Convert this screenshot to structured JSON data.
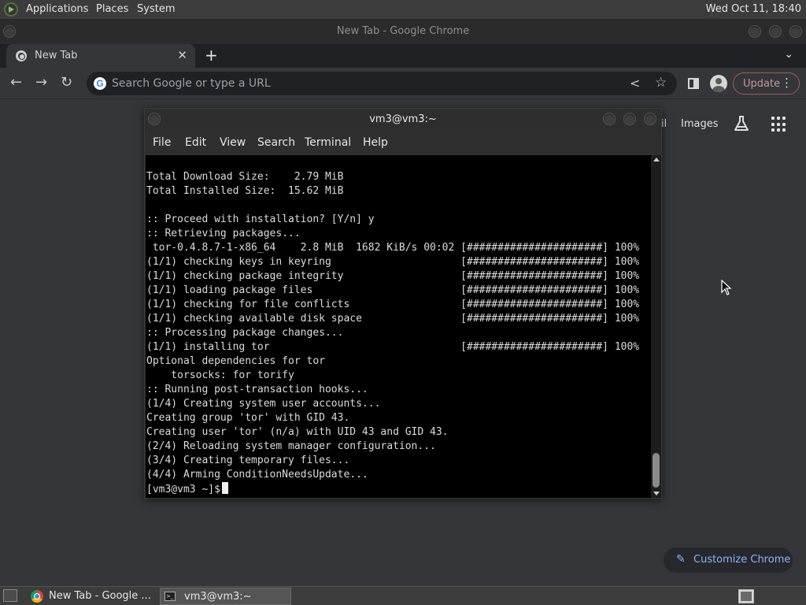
{
  "top_panel": {
    "menus": [
      "Applications",
      "Places",
      "System"
    ],
    "clock": "Wed Oct 11, 18:40"
  },
  "chrome": {
    "window_title": "New Tab - Google Chrome",
    "tab_title": "New Tab",
    "omnibox_placeholder": "Search Google or type a URL",
    "update_label": "Update",
    "ntp": {
      "gmail_tail": "il",
      "images_link": "Images",
      "customize_label": "Customize Chrome"
    }
  },
  "terminal": {
    "title": "vm3@vm3:~",
    "menu": [
      "File",
      "Edit",
      "View",
      "Search",
      "Terminal",
      "Help"
    ],
    "lines": [
      "Total Download Size:    2.79 MiB",
      "Total Installed Size:  15.62 MiB",
      "",
      ":: Proceed with installation? [Y/n] y",
      ":: Retrieving packages...",
      " tor-0.4.8.7-1-x86_64    2.8 MiB  1682 KiB/s 00:02 [######################] 100%",
      "(1/1) checking keys in keyring                     [######################] 100%",
      "(1/1) checking package integrity                   [######################] 100%",
      "(1/1) loading package files                        [######################] 100%",
      "(1/1) checking for file conflicts                  [######################] 100%",
      "(1/1) checking available disk space                [######################] 100%",
      ":: Processing package changes...",
      "(1/1) installing tor                               [######################] 100%",
      "Optional dependencies for tor",
      "    torsocks: for torify",
      ":: Running post-transaction hooks...",
      "(1/4) Creating system user accounts...",
      "Creating group 'tor' with GID 43.",
      "Creating user 'tor' (n/a) with UID 43 and GID 43.",
      "(2/4) Reloading system manager configuration...",
      "(3/4) Creating temporary files...",
      "(4/4) Arming ConditionNeedsUpdate..."
    ],
    "prompt": "[vm3@vm3 ~]$"
  },
  "taskbar": {
    "tasks": [
      "New Tab - Google ...",
      "vm3@vm3:~"
    ]
  }
}
